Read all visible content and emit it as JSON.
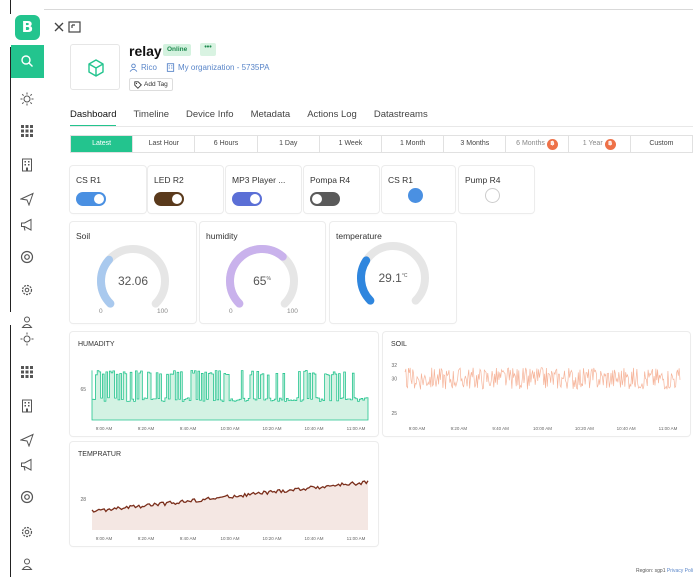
{
  "app": {
    "logo_letter": "B"
  },
  "device": {
    "name": "relay",
    "status": "Online",
    "more_label": "•••",
    "owner": "Rico",
    "organization": "My organization - 5735PA",
    "add_tag_label": "Add Tag"
  },
  "tabs": [
    {
      "label": "Dashboard",
      "active": true
    },
    {
      "label": "Timeline",
      "active": false
    },
    {
      "label": "Device Info",
      "active": false
    },
    {
      "label": "Metadata",
      "active": false
    },
    {
      "label": "Actions Log",
      "active": false
    },
    {
      "label": "Datastreams",
      "active": false
    }
  ],
  "time_ranges": [
    {
      "label": "Latest",
      "active": true,
      "locked": false
    },
    {
      "label": "Last Hour",
      "active": false,
      "locked": false
    },
    {
      "label": "6 Hours",
      "active": false,
      "locked": false
    },
    {
      "label": "1 Day",
      "active": false,
      "locked": false
    },
    {
      "label": "1 Week",
      "active": false,
      "locked": false
    },
    {
      "label": "1 Month",
      "active": false,
      "locked": false
    },
    {
      "label": "3 Months",
      "active": false,
      "locked": false
    },
    {
      "label": "6 Months",
      "active": false,
      "locked": true
    },
    {
      "label": "1 Year",
      "active": false,
      "locked": true
    },
    {
      "label": "Custom",
      "active": false,
      "locked": false
    }
  ],
  "lock_glyph": "฿",
  "switches": [
    {
      "label": "CS R1",
      "on": true,
      "color": "#4a90e2"
    },
    {
      "label": "LED R2",
      "on": true,
      "color": "#5a3a1c"
    },
    {
      "label": "MP3 Player ...",
      "on": true,
      "color": "#5b6fd6"
    },
    {
      "label": "Pompa R4",
      "on": false,
      "color": "#5a5a5a"
    }
  ],
  "leds": [
    {
      "label": "CS R1",
      "on": true,
      "color": "#4a90e2"
    },
    {
      "label": "Pump R4",
      "on": false,
      "color": "#cccccc"
    }
  ],
  "gauges": [
    {
      "label": "Soil",
      "value": "32.06",
      "unit": "",
      "min": "0",
      "max": "100",
      "fraction": 0.3206,
      "color": "#a9c9ee"
    },
    {
      "label": "humidity",
      "value": "65",
      "unit": "%",
      "min": "0",
      "max": "100",
      "fraction": 0.65,
      "color": "#c9b2ec"
    },
    {
      "label": "temperature",
      "value": "29.1",
      "unit": "°C",
      "min": "",
      "max": "",
      "fraction": 0.29,
      "color": "#2f86de"
    }
  ],
  "chart_data": [
    {
      "type": "area",
      "title": "HUMADITY",
      "color": "#23c48e",
      "x_ticks": [
        "9:00 AM",
        "9:20 AM",
        "9:40 AM",
        "10:00 AM",
        "10:20 AM",
        "10:40 AM",
        "11:00 AM"
      ],
      "y_ticks": [
        "65"
      ],
      "low": 63,
      "high": 68,
      "ylim": [
        60,
        70
      ]
    },
    {
      "type": "line",
      "title": "SOIL",
      "color": "#f6b49a",
      "x_ticks": [
        "9:00 AM",
        "9:20 AM",
        "9:40 AM",
        "10:00 AM",
        "10:20 AM",
        "10:40 AM",
        "11:00 AM"
      ],
      "y_ticks": [
        "32",
        "30",
        "25"
      ],
      "mean": 30,
      "ylim": [
        24,
        33
      ]
    },
    {
      "type": "area",
      "title": "TEMPRATUR",
      "color": "#7a2e1b",
      "x_ticks": [
        "9:00 AM",
        "9:20 AM",
        "9:40 AM",
        "10:00 AM",
        "10:20 AM",
        "10:40 AM",
        "11:00 AM"
      ],
      "y_ticks": [
        "28"
      ],
      "start": 27.2,
      "end": 29.1,
      "ylim": [
        26,
        30
      ]
    }
  ],
  "footer": {
    "region": "Region: sgp1",
    "privacy": "Privacy Poli"
  }
}
